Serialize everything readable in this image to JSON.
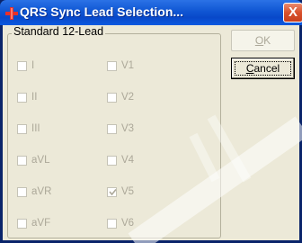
{
  "window": {
    "title": "QRS Sync Lead Selection...",
    "close_symbol": "X",
    "title_icon": "heart-lead-icon"
  },
  "group": {
    "label": "Standard 12-Lead",
    "leads": [
      {
        "label": "I",
        "checked": false
      },
      {
        "label": "II",
        "checked": false
      },
      {
        "label": "III",
        "checked": false
      },
      {
        "label": "aVL",
        "checked": false
      },
      {
        "label": "aVR",
        "checked": false
      },
      {
        "label": "aVF",
        "checked": false
      },
      {
        "label": "V1",
        "checked": false
      },
      {
        "label": "V2",
        "checked": false
      },
      {
        "label": "V3",
        "checked": false
      },
      {
        "label": "V4",
        "checked": false
      },
      {
        "label": "V5",
        "checked": true
      },
      {
        "label": "V6",
        "checked": false
      }
    ]
  },
  "buttons": {
    "ok_accel": "O",
    "ok_rest": "K",
    "cancel_accel": "C",
    "cancel_rest": "ancel"
  },
  "colors": {
    "titlebar": "#0f56d3",
    "dialog_bg": "#ece9d8",
    "close_button": "#d9512c",
    "disabled_text": "#aca899"
  }
}
